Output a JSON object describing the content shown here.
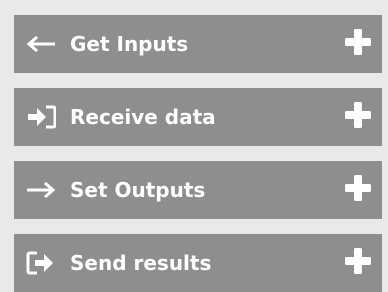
{
  "panel": {
    "items": [
      {
        "label": "Get Inputs",
        "icon": "arrow-left-icon"
      },
      {
        "label": "Receive data",
        "icon": "sign-in-icon"
      },
      {
        "label": "Set Outputs",
        "icon": "arrow-right-icon"
      },
      {
        "label": "Send results",
        "icon": "sign-out-icon"
      }
    ],
    "add_icon": "plus-icon"
  },
  "colors": {
    "background": "#e9e9e9",
    "item_background": "#8e8e8e",
    "text": "#ffffff"
  }
}
